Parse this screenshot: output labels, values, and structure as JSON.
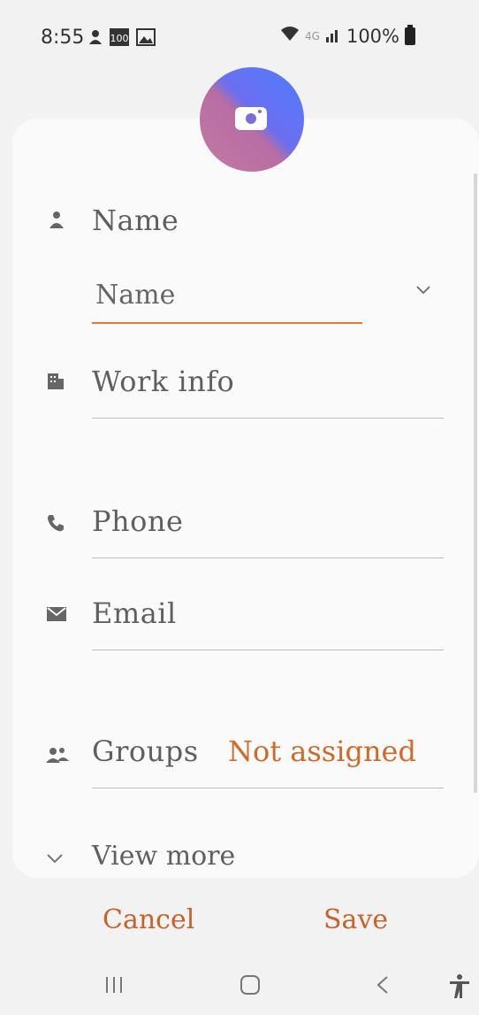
{
  "status": {
    "time": "8:55",
    "network": "4G",
    "battery": "100%"
  },
  "form": {
    "name_label": "Name",
    "name_placeholder": "Name",
    "work_info_label": "Work info",
    "phone_label": "Phone",
    "email_label": "Email",
    "groups_label": "Groups",
    "groups_value": "Not assigned",
    "view_more_label": "View more"
  },
  "actions": {
    "cancel_label": "Cancel",
    "save_label": "Save"
  },
  "colors": {
    "accent": "#d06a2b",
    "background": "#f2f2f2",
    "card": "#fafafa"
  }
}
